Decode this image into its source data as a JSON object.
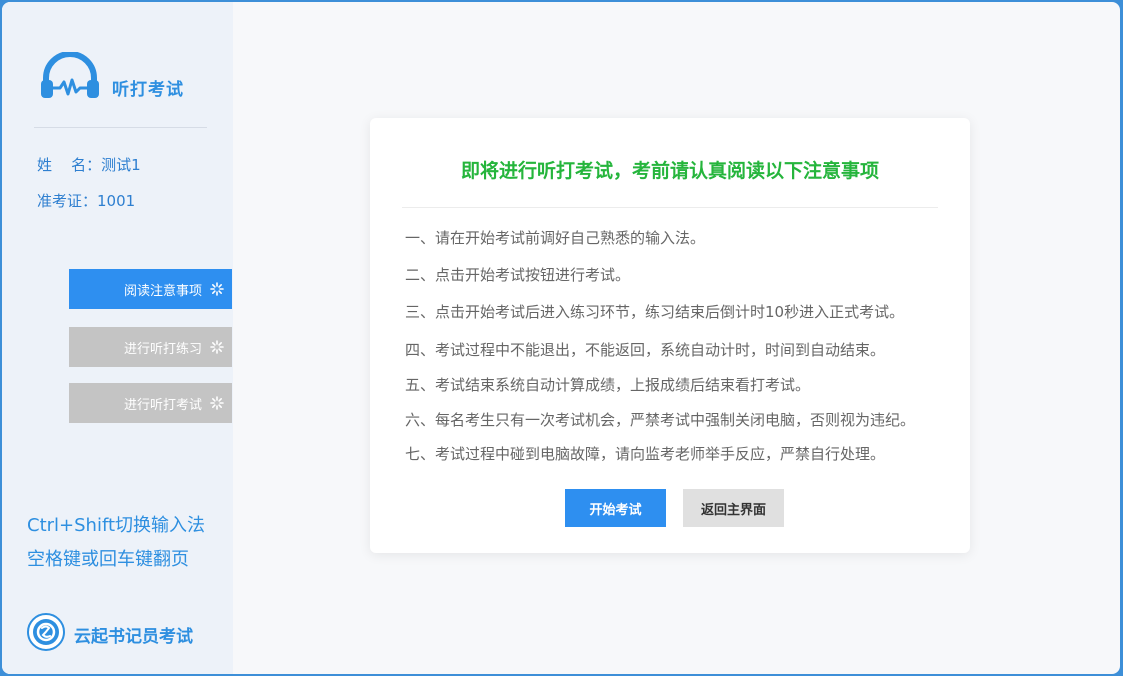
{
  "app": {
    "title": "听打考试",
    "brand": "云起书记员考试"
  },
  "candidate": {
    "name_label": "姓    名：",
    "name_value": "测试1",
    "id_label": "准考证：",
    "id_value": "1001"
  },
  "steps": [
    {
      "label": "阅读注意事项",
      "active": true
    },
    {
      "label": "进行听打练习",
      "active": false
    },
    {
      "label": "进行听打考试",
      "active": false
    }
  ],
  "hints": [
    "Ctrl+Shift切换输入法",
    "空格键或回车键翻页"
  ],
  "dialog": {
    "title": "即将进行听打考试，考前请认真阅读以下注意事项",
    "rules": [
      "一、请在开始考试前调好自己熟悉的输入法。",
      "二、点击开始考试按钮进行考试。",
      "三、点击开始考试后进入练习环节，练习结束后倒计时10秒进入正式考试。",
      "四、考试过程中不能退出，不能返回，系统自动计时，时间到自动结束。",
      "五、考试结束系统自动计算成绩，上报成绩后结束看打考试。",
      "六、每名考生只有一次考试机会，严禁考试中强制关闭电脑，否则视为违纪。",
      "七、考试过程中碰到电脑故障，请向监考老师举手反应，严禁自行处理。"
    ],
    "start_label": "开始考试",
    "back_label": "返回主界面"
  },
  "colors": {
    "accent": "#2e8ff0",
    "title_green": "#25b53c",
    "step_inactive": "#c4c4c4"
  },
  "icons": {
    "logo": "headphones-waveform-icon",
    "step": "loading-spinner-icon",
    "brand": "brand-circle-icon"
  }
}
